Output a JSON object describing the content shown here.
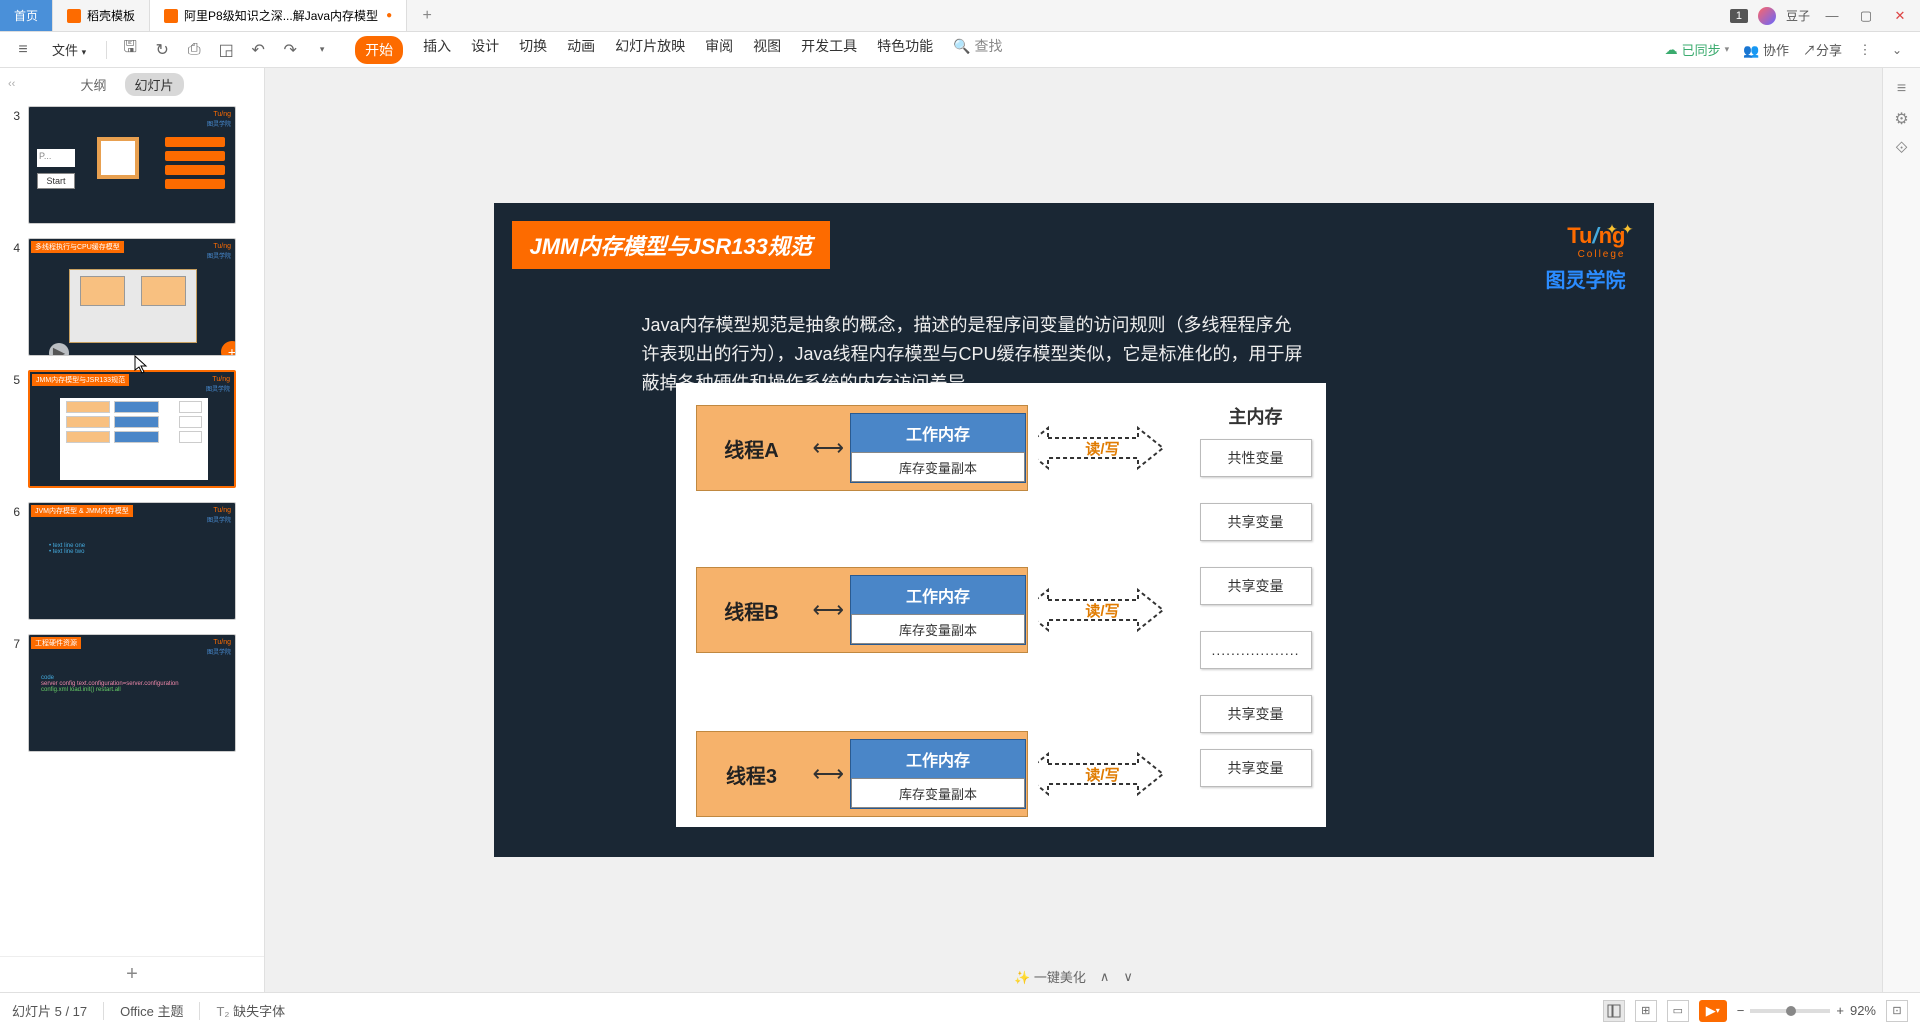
{
  "tabs": {
    "home": "首页",
    "docker": "稻壳模板",
    "doc": "阿里P8级知识之深...解Java内存模型"
  },
  "titlebar": {
    "badge": "1",
    "user": "豆子"
  },
  "toolbar": {
    "file": "文件",
    "menus": [
      "开始",
      "插入",
      "设计",
      "切换",
      "动画",
      "幻灯片放映",
      "审阅",
      "视图",
      "开发工具",
      "特色功能"
    ],
    "search": "查找",
    "synced": "已同步",
    "collab": "协作",
    "share": "分享"
  },
  "panel": {
    "outline": "大纲",
    "slides": "幻灯片"
  },
  "thumbs": {
    "n3": "3",
    "n4": "4",
    "n5": "5",
    "n6": "6",
    "n7": "7",
    "start": "Start",
    "p": "P..."
  },
  "slide": {
    "title": "JMM内存模型与JSR133规范",
    "logo_college": "College",
    "logo_cn": "图灵学院",
    "desc": "Java内存模型规范是抽象的概念，描述的是程序间变量的访问规则（多线程程序允许表现出的行为），Java线程内存模型与CPU缓存模型类似，它是标准化的，用于屏蔽掉各种硬件和操作系统的内存访问差异",
    "threadA": "线程A",
    "threadB": "线程B",
    "thread3": "线程3",
    "work_mem": "工作内存",
    "var_copy": "库存变量副本",
    "rw": "读/写",
    "main_mem": "主内存",
    "shared1": "共性变量",
    "shared": "共享变量",
    "dots": ".................."
  },
  "bottom_nav": {
    "beautify": "一键美化"
  },
  "status": {
    "slide_pos": "幻灯片 5 / 17",
    "theme": "Office 主题",
    "missing_font": "缺失字体",
    "zoom": "92%"
  }
}
